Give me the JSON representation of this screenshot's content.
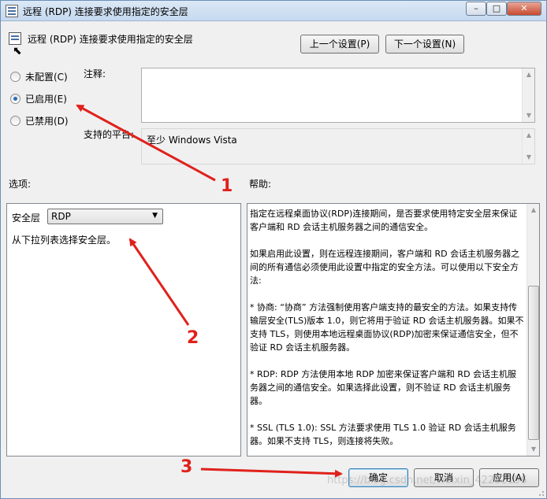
{
  "window": {
    "title": "远程 (RDP) 连接要求使用指定的安全层",
    "minimize": "–",
    "maximize": "□",
    "close": "✕"
  },
  "header": {
    "title": "远程 (RDP) 连接要求使用指定的安全层",
    "prev_setting": "上一个设置(P)",
    "next_setting": "下一个设置(N)"
  },
  "state": {
    "options": [
      {
        "label": "未配置(C)",
        "selected": false
      },
      {
        "label": "已启用(E)",
        "selected": true
      },
      {
        "label": "已禁用(D)",
        "selected": false
      }
    ]
  },
  "comment": {
    "label": "注释:",
    "value": ""
  },
  "platform": {
    "label": "支持的平台:",
    "value": "至少 Windows Vista"
  },
  "options_section": {
    "label": "选项:",
    "security_layer_label": "安全层",
    "security_layer_value": "RDP",
    "hint": "从下拉列表选择安全层。"
  },
  "help_section": {
    "label": "帮助:",
    "paragraphs": [
      "指定在远程桌面协议(RDP)连接期间，是否要求使用特定安全层来保证客户端和 RD 会话主机服务器之间的通信安全。",
      "如果启用此设置，则在远程连接期间，客户端和 RD 会话主机服务器之间的所有通信必须使用此设置中指定的安全方法。可以使用以下安全方法:",
      "* 协商: “协商” 方法强制使用客户端支持的最安全的方法。如果支持传输层安全(TLS)版本 1.0，则它将用于验证 RD 会话主机服务器。如果不支持 TLS，则使用本地远程桌面协议(RDP)加密来保证通信安全，但不验证 RD 会话主机服务器。",
      "* RDP: RDP 方法使用本地 RDP 加密来保证客户端和 RD 会话主机服务器之间的通信安全。如果选择此设置，则不验证 RD 会话主机服务器。",
      "* SSL (TLS 1.0): SSL 方法要求使用 TLS 1.0 验证 RD 会话主机服务器。如果不支持 TLS，则连接将失败。"
    ]
  },
  "footer": {
    "ok": "确定",
    "cancel": "取消",
    "apply": "应用(A)"
  },
  "annotations": {
    "n1": "1",
    "n2": "2",
    "n3": "3"
  },
  "watermark": "https://blog.csdn.net/weixin_42232156",
  "colors": {
    "arrow": "#e0211b",
    "accent": "#2a6bb6"
  }
}
